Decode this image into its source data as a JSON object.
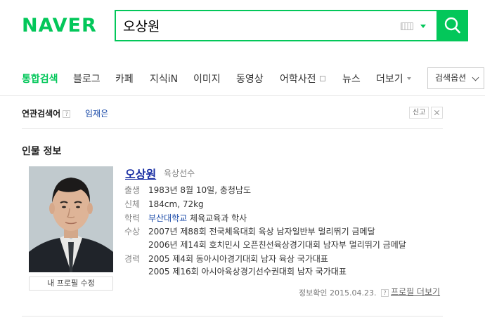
{
  "header": {
    "logo": "NAVER",
    "search": {
      "value": "오상원"
    }
  },
  "tabs": [
    {
      "label": "통합검색"
    },
    {
      "label": "블로그"
    },
    {
      "label": "카페"
    },
    {
      "label": "지식iN"
    },
    {
      "label": "이미지"
    },
    {
      "label": "동영상"
    },
    {
      "label": "어학사전"
    },
    {
      "label": "뉴스"
    },
    {
      "label": "더보기"
    }
  ],
  "search_options_label": "검색옵션",
  "related": {
    "title": "연관검색어",
    "help": "?",
    "keyword": "임재은",
    "report_label": "신고"
  },
  "person": {
    "section_title": "인물 정보",
    "name": "오상원",
    "occupation": "육상선수",
    "edit_profile_label": "내 프로필 수정",
    "info": {
      "birth_key": "출생",
      "birth": "1983년 8월 10일, 충청남도",
      "body_key": "신체",
      "body": "184cm, 72kg",
      "edu_key": "학력",
      "edu_school": "부산대학교",
      "edu_dept": "체육교육과 학사",
      "award_key": "수상",
      "award_1": "2007년 제88회 전국체육대회 육상 남자일반부 멀리뛰기 금메달",
      "award_2": "2006년 제14회 호치민시 오픈친선육상경기대회 남자부 멀리뛰기 금메달",
      "career_key": "경력",
      "career_1": "2005 제4회 동아시아경기대회 남자 육상 국가대표",
      "career_2": "2005 제16회 아시아육상경기선수권대회 남자 국가대표"
    },
    "verified_label": "정보확인",
    "verified_date": "2015.04.23.",
    "verified_help": "?",
    "more_profile": "프로필 더보기"
  },
  "colors": {
    "brand": "#03c75a",
    "link": "#1a4aa8",
    "name_link": "#1a2fa3"
  }
}
